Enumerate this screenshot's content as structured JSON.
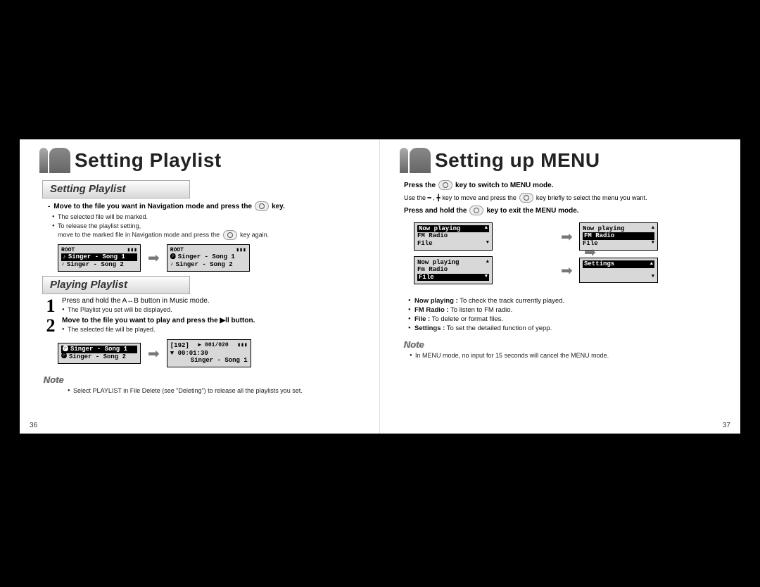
{
  "left": {
    "title": "Setting Playlist",
    "section1": {
      "header": "Setting Playlist"
    },
    "instr1": {
      "pre": "Move to the file you want in Navigation mode and press the",
      "post": "key."
    },
    "bullets1": [
      "The selected file will be marked.",
      "To release the playlist setting,"
    ],
    "bullets1_cont_pre": "move to the marked file in Navigation mode and press the",
    "bullets1_cont_post": "key again.",
    "lcds_root": {
      "title": "ROOT",
      "rows": [
        "Singer - Song 1",
        "Singer - Song 2"
      ]
    },
    "section2": {
      "header": "Playing Playlist"
    },
    "step1": {
      "text": "Press and hold the A↔B button in Music mode.",
      "bullets": [
        "The Playlist you set will be displayed."
      ]
    },
    "step2": {
      "text": "Move to the file you want to play and press the ▶ll button.",
      "bullets": [
        "The selected file will be played."
      ]
    },
    "lcds_play": {
      "left": {
        "rows": [
          "Singer - Song 1",
          "Singer - Song 2"
        ]
      },
      "right": {
        "track": "▶ 001/020",
        "time": "▼ 00:01:30",
        "now": "Singer - Song 1",
        "bitrate": "192"
      }
    },
    "note_label": "Note",
    "note_text": "Select PLAYLIST in File Delete (see \"Deleting\") to release all the playlists you set.",
    "pagenum": "36"
  },
  "right": {
    "title": "Setting up MENU",
    "line1": {
      "pre": "Press the",
      "post": "key to switch to MENU mode."
    },
    "line2": {
      "pre": "Use the ━ , ╋ key to move and press the",
      "post": "key briefly to select the menu you want."
    },
    "line3": {
      "pre": "Press and hold the",
      "post": "key to exit the MENU mode."
    },
    "menus": {
      "a": {
        "sel": "Now playing",
        "rows": [
          "FM Radio",
          "File"
        ]
      },
      "b": {
        "rows": [
          "Now playing"
        ],
        "sel": "FM Radio",
        "rows2": [
          "File"
        ]
      },
      "c": {
        "rows": [
          "Now playing",
          "Fm Radio"
        ],
        "sel": "File"
      },
      "d": {
        "sel": "Settings"
      }
    },
    "defs": [
      {
        "term": "Now playing :",
        "desc": "To check the track currently played."
      },
      {
        "term": "FM Radio :",
        "desc": "To listen to FM radio."
      },
      {
        "term": "File :",
        "desc": "To delete or format  files."
      },
      {
        "term": "Settings :",
        "desc": "To set the detailed function of yepp."
      }
    ],
    "note_label": "Note",
    "note_text": "In MENU mode, no input for 15 seconds will cancel the MENU mode.",
    "pagenum": "37"
  }
}
